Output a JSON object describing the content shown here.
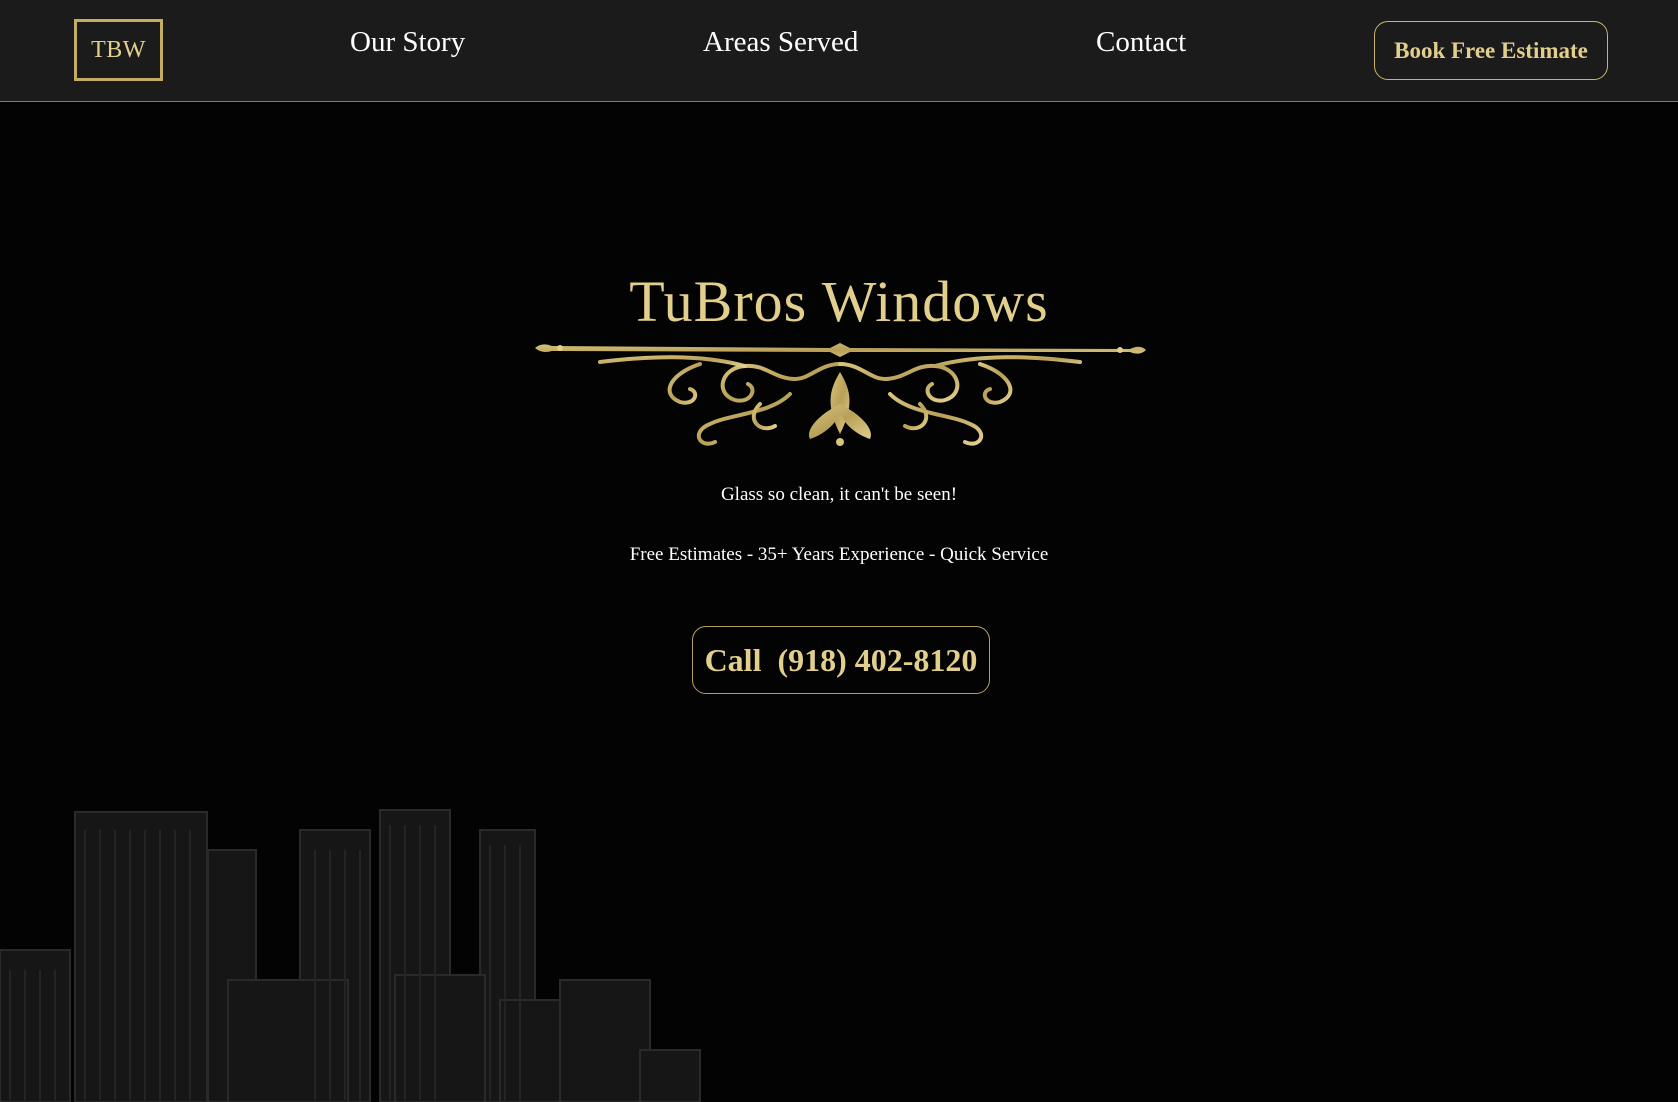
{
  "nav": {
    "logo": "TBW",
    "links": [
      "Our Story",
      "Areas Served",
      "Contact"
    ],
    "cta": "Book Free Estimate"
  },
  "hero": {
    "title": "TuBros Windows",
    "tagline": "Glass so clean, it can't be seen!",
    "features": "Free Estimates - 35+ Years Experience - Quick Service",
    "call_button": "Call  (918) 402-8120"
  },
  "colors": {
    "gold": "#e2cf8c",
    "nav_bg": "#1b1b1b",
    "page_bg": "#030303"
  }
}
